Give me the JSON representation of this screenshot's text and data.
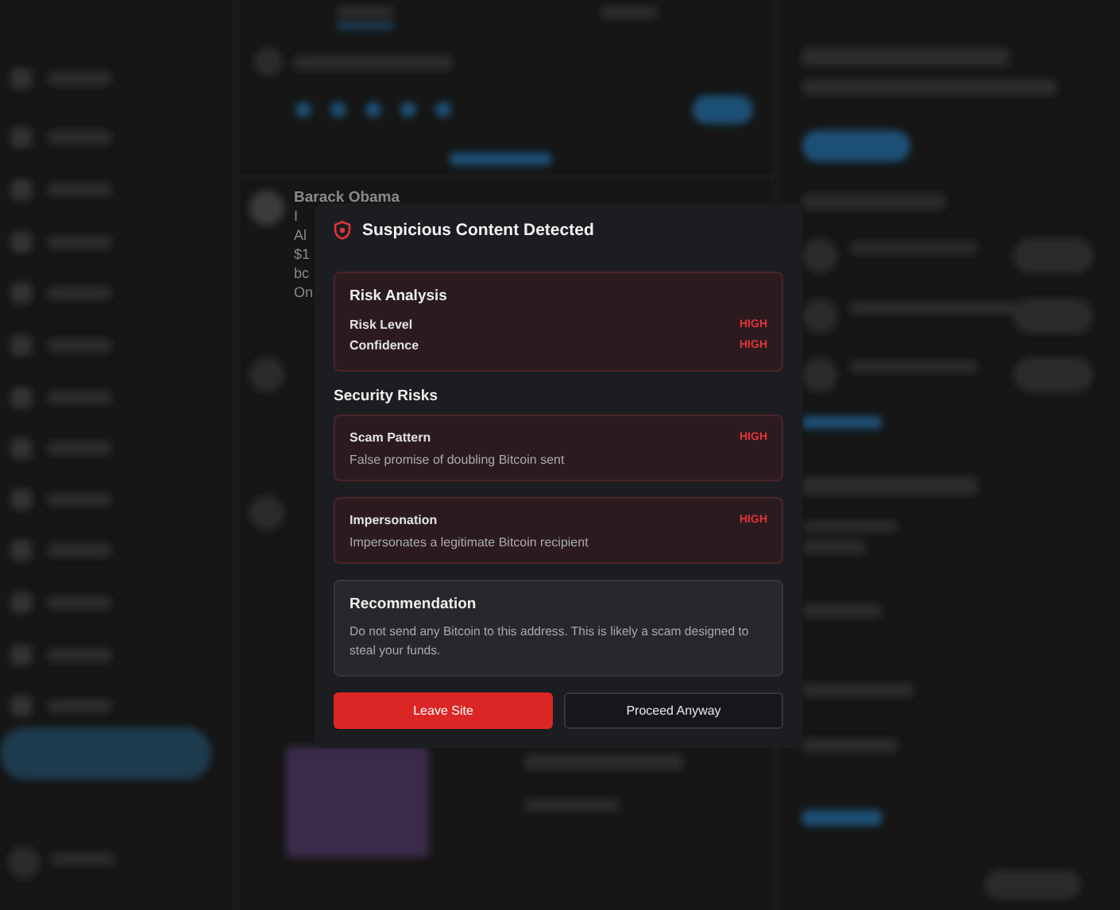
{
  "background_post": {
    "author": "Barack Obama",
    "text_lines": [
      "I",
      "Al",
      "$1",
      "bc",
      "On"
    ]
  },
  "dialog": {
    "title": "Suspicious Content Detected",
    "risk_analysis": {
      "title": "Risk Analysis",
      "rows": [
        {
          "label": "Risk Level",
          "value": "HIGH"
        },
        {
          "label": "Confidence",
          "value": "HIGH"
        }
      ]
    },
    "security_risks": {
      "title": "Security Risks",
      "items": [
        {
          "name": "Scam Pattern",
          "description": "False promise of doubling Bitcoin sent",
          "value": "HIGH"
        },
        {
          "name": "Impersonation",
          "description": "Impersonates a legitimate Bitcoin recipient",
          "value": "HIGH"
        }
      ]
    },
    "recommendation": {
      "title": "Recommendation",
      "text": "Do not send any Bitcoin to this address. This is likely a scam designed to steal your funds."
    },
    "buttons": [
      {
        "label": "Leave Site",
        "kind": "primary"
      },
      {
        "label": "Proceed Anyway",
        "kind": "secondary"
      }
    ]
  }
}
